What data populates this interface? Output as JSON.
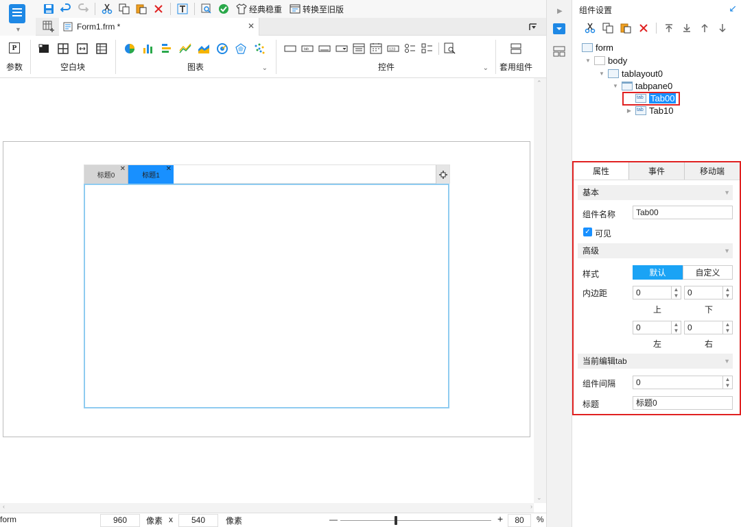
{
  "toolbar": {
    "classic_label": "经典稳重",
    "switch_label": "转换至旧版"
  },
  "file_tab": {
    "name": "Form1.frm *"
  },
  "ribbon": {
    "params_label": "参数",
    "blank_label": "空白块",
    "chart_label": "图表",
    "widget_label": "控件",
    "template_label": "套用组件"
  },
  "canvas": {
    "tabs": [
      {
        "label": "标题0",
        "active": false
      },
      {
        "label": "标题1",
        "active": true
      }
    ]
  },
  "status": {
    "name": "form",
    "width": "960",
    "unit1": "像素",
    "x_sep": "x",
    "height": "540",
    "unit2": "像素",
    "minus": "—",
    "plus": "+",
    "zoom": "80",
    "percent": "%"
  },
  "panel": {
    "title": "组件设置",
    "tree": {
      "form": "form",
      "body": "body",
      "tablayout": "tablayout0",
      "tabpane": "tabpane0",
      "tab00": "Tab00",
      "tab10": "Tab10"
    }
  },
  "props": {
    "tabs": [
      "属性",
      "事件",
      "移动端"
    ],
    "basic": "基本",
    "name_label": "组件名称",
    "name_value": "Tab00",
    "visible_label": "可见",
    "advanced": "高级",
    "style_label": "样式",
    "style_default": "默认",
    "style_custom": "自定义",
    "padding_label": "内边距",
    "pad_top": "0",
    "pad_top_label": "上",
    "pad_bottom": "0",
    "pad_bottom_label": "下",
    "pad_left": "0",
    "pad_left_label": "左",
    "pad_right": "0",
    "pad_right_label": "右",
    "current_tab": "当前编辑tab",
    "gap_label": "组件间隔",
    "gap_value": "0",
    "title_label": "标题",
    "title_value": "标题0"
  }
}
